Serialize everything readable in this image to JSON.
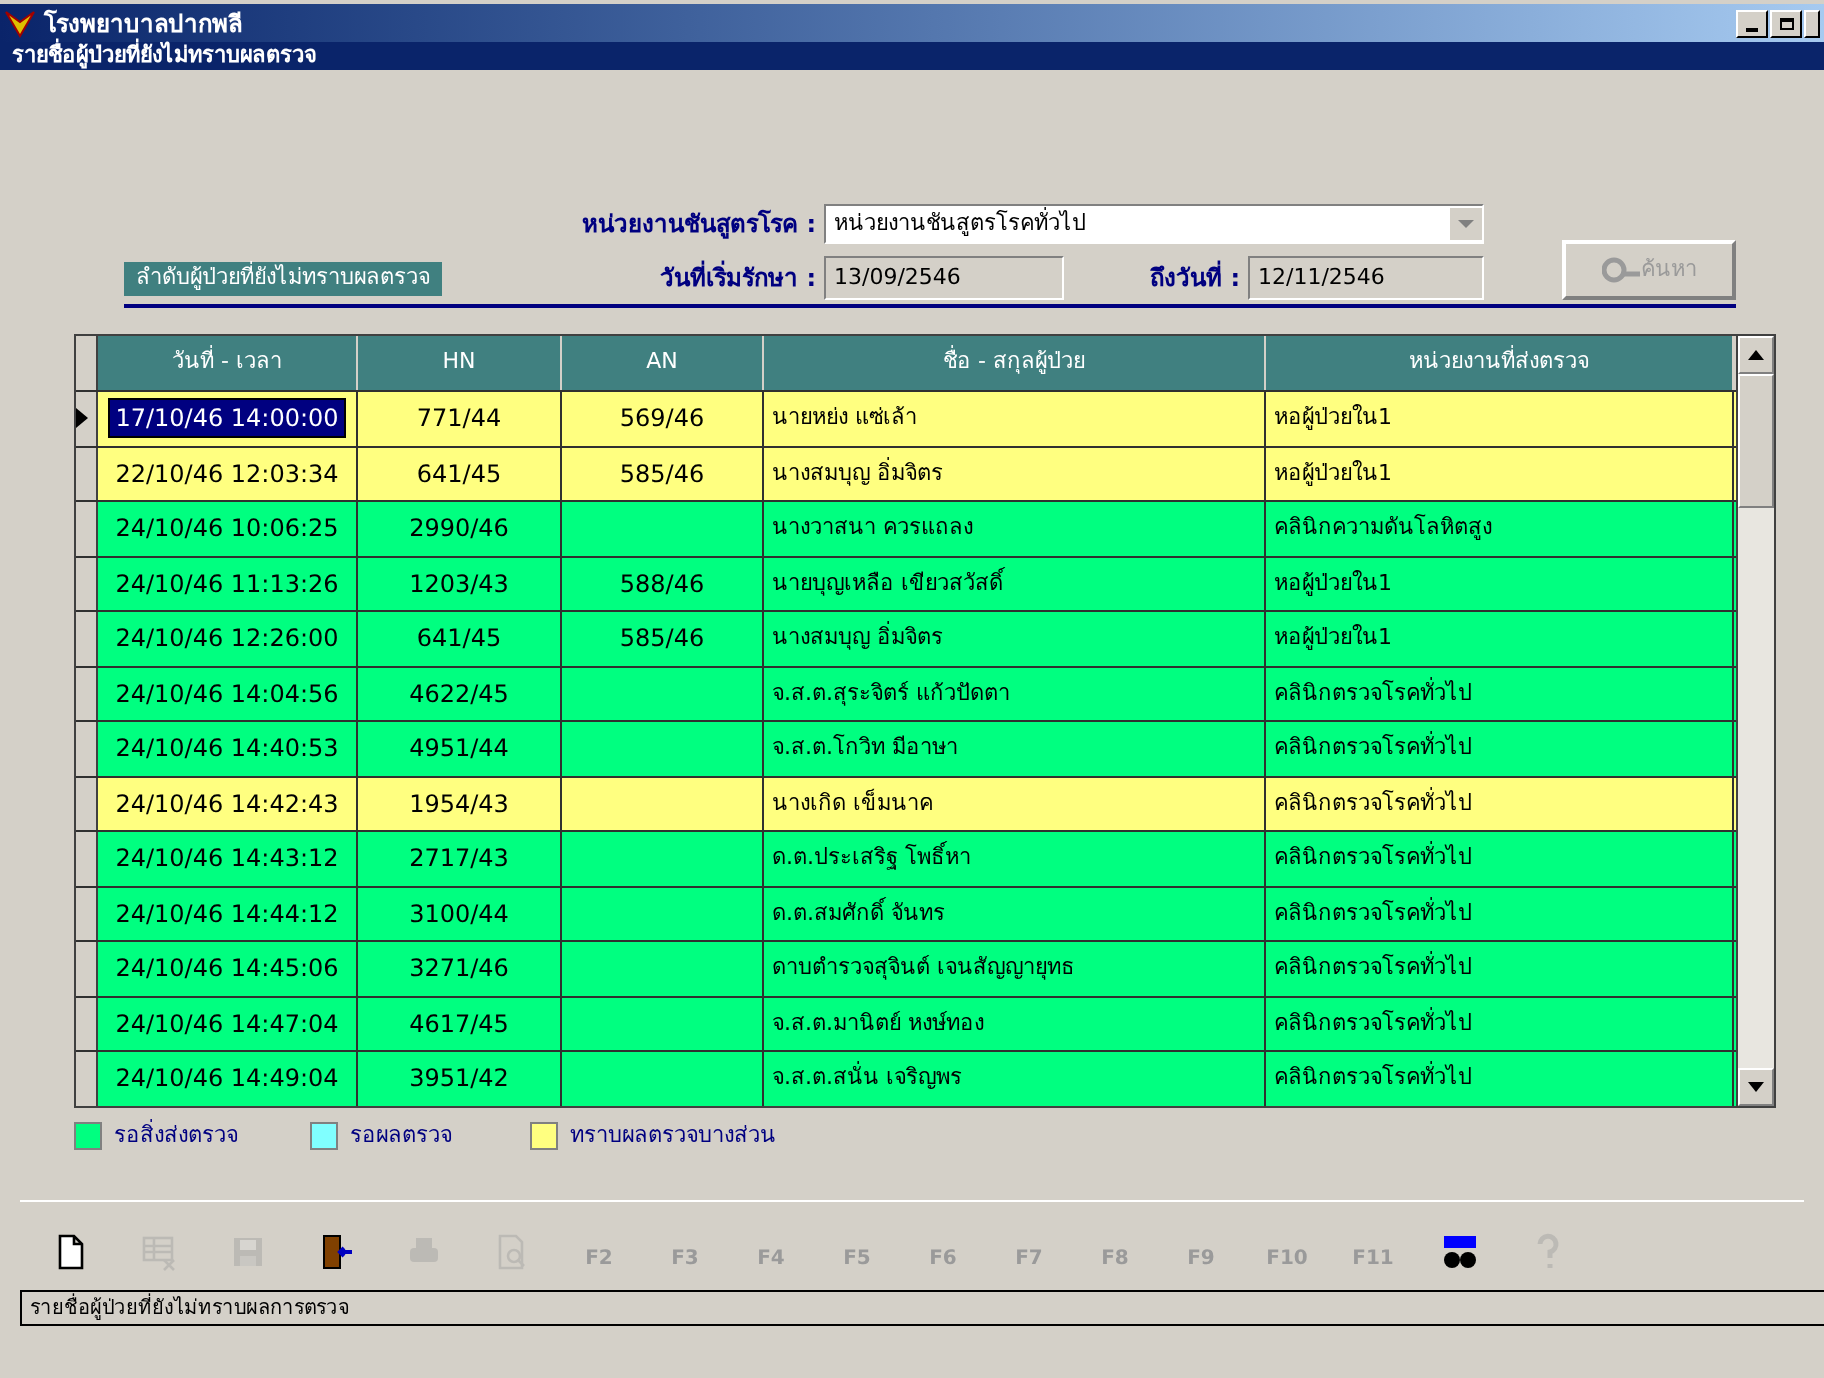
{
  "window": {
    "title": "โรงพยาบาลปากพลี"
  },
  "subwindow": {
    "title": "รายชื่อผู้ป่วยที่ยังไม่ทราบผลตรวจ"
  },
  "filters": {
    "unit_label": "หน่วยงานชันสูตรโรค :",
    "unit_value": "หน่วยงานชันสูตรโรคทั่วไป",
    "start_label": "วันที่เริ่มรักษา :",
    "start_value": "13/09/2546",
    "end_label": "ถึงวันที่ :",
    "end_value": "12/11/2546",
    "search_button": {
      "label": "ค้นหา",
      "disabled": true
    }
  },
  "section_label": "ลำดับผู้ป่วยที่ยังไม่ทราบผลตรวจ",
  "table": {
    "columns": [
      "วันที่ - เวลา",
      "HN",
      "AN",
      "ชื่อ - สกุลผู้ป่วย",
      "หน่วยงานที่ส่งตรวจ"
    ],
    "rows": [
      {
        "cells": [
          "17/10/46 14:00:00",
          "771/44",
          "569/46",
          "นายหย่ง แซ่เล้า",
          "หอผู้ป่วยใน1"
        ],
        "color": "#ffff80",
        "selected": true
      },
      {
        "cells": [
          "22/10/46 12:03:34",
          "641/45",
          "585/46",
          "นางสมบุญ อิ่มจิตร",
          "หอผู้ป่วยใน1"
        ],
        "color": "#ffff80",
        "selected": false
      },
      {
        "cells": [
          "24/10/46 10:06:25",
          "2990/46",
          "",
          "นางวาสนา ควรแถลง",
          "คลินิกความดันโลหิตสูง"
        ],
        "color": "#00ff80",
        "selected": false
      },
      {
        "cells": [
          "24/10/46 11:13:26",
          "1203/43",
          "588/46",
          "นายบุญเหลือ เขียวสวัสดิ์",
          "หอผู้ป่วยใน1"
        ],
        "color": "#00ff80",
        "selected": false
      },
      {
        "cells": [
          "24/10/46 12:26:00",
          "641/45",
          "585/46",
          "นางสมบุญ อิ่มจิตร",
          "หอผู้ป่วยใน1"
        ],
        "color": "#00ff80",
        "selected": false
      },
      {
        "cells": [
          "24/10/46 14:04:56",
          "4622/45",
          "",
          "จ.ส.ต.สุระจิตร์ แก้วปัดตา",
          "คลินิกตรวจโรคทั่วไป"
        ],
        "color": "#00ff80",
        "selected": false
      },
      {
        "cells": [
          "24/10/46 14:40:53",
          "4951/44",
          "",
          "จ.ส.ต.โกวิท มีอาษา",
          "คลินิกตรวจโรคทั่วไป"
        ],
        "color": "#00ff80",
        "selected": false
      },
      {
        "cells": [
          "24/10/46 14:42:43",
          "1954/43",
          "",
          "นางเกิด เข็มนาค",
          "คลินิกตรวจโรคทั่วไป"
        ],
        "color": "#ffff80",
        "selected": false
      },
      {
        "cells": [
          "24/10/46 14:43:12",
          "2717/43",
          "",
          "ด.ต.ประเสริฐ โพธิ์หา",
          "คลินิกตรวจโรคทั่วไป"
        ],
        "color": "#00ff80",
        "selected": false
      },
      {
        "cells": [
          "24/10/46 14:44:12",
          "3100/44",
          "",
          "ด.ต.สมศักดิ์ จันทร",
          "คลินิกตรวจโรคทั่วไป"
        ],
        "color": "#00ff80",
        "selected": false
      },
      {
        "cells": [
          "24/10/46 14:45:06",
          "3271/46",
          "",
          "ดาบตำรวจสุจินต์ เจนสัญญายุทธ",
          "คลินิกตรวจโรคทั่วไป"
        ],
        "color": "#00ff80",
        "selected": false
      },
      {
        "cells": [
          "24/10/46 14:47:04",
          "4617/45",
          "",
          "จ.ส.ต.มานิตย์ หงษ์ทอง",
          "คลินิกตรวจโรคทั่วไป"
        ],
        "color": "#00ff80",
        "selected": false
      },
      {
        "cells": [
          "24/10/46 14:49:04",
          "3951/42",
          "",
          "จ.ส.ต.สนั่น เจริญพร",
          "คลินิกตรวจโรคทั่วไป"
        ],
        "color": "#00ff80",
        "selected": false
      }
    ]
  },
  "legend": [
    {
      "label": "รอสิ่งส่งตรวจ",
      "color": "#00ff80"
    },
    {
      "label": "รอผลตรวจ",
      "color": "#80ffff"
    },
    {
      "label": "ทราบผลตรวจบางส่วน",
      "color": "#ffff80"
    }
  ],
  "toolbar": [
    {
      "kind": "icon",
      "disabled": false
    },
    {
      "kind": "icon",
      "disabled": true
    },
    {
      "kind": "icon",
      "disabled": true
    },
    {
      "kind": "icon",
      "disabled": false
    },
    {
      "kind": "icon",
      "disabled": true
    },
    {
      "kind": "icon",
      "disabled": true
    },
    {
      "kind": "key",
      "label": "F2",
      "disabled": true
    },
    {
      "kind": "key",
      "label": "F3",
      "disabled": true
    },
    {
      "kind": "key",
      "label": "F4",
      "disabled": true
    },
    {
      "kind": "key",
      "label": "F5",
      "disabled": true
    },
    {
      "kind": "key",
      "label": "F6",
      "disabled": true
    },
    {
      "kind": "key",
      "label": "F7",
      "disabled": true
    },
    {
      "kind": "key",
      "label": "F8",
      "disabled": true
    },
    {
      "kind": "key",
      "label": "F9",
      "disabled": true
    },
    {
      "kind": "key",
      "label": "F10",
      "disabled": true
    },
    {
      "kind": "key",
      "label": "F11",
      "disabled": true
    },
    {
      "kind": "icon",
      "disabled": false
    },
    {
      "kind": "icon",
      "disabled": true
    }
  ],
  "status_bar": "รายชื่อผู้ป่วยที่ยังไม่ทราบผลการตรวจ"
}
